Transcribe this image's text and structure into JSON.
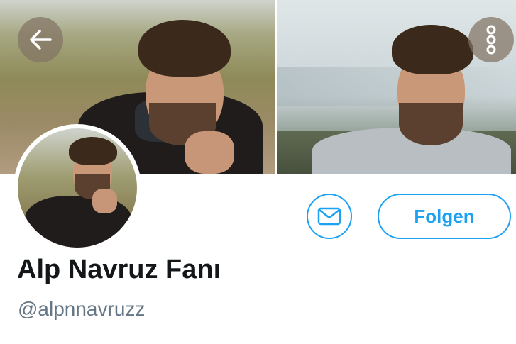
{
  "header": {
    "back_icon": "arrow-left-icon",
    "more_icon": "more-vertical-icon"
  },
  "actions": {
    "message_icon": "mail-icon",
    "follow_label": "Folgen",
    "accent_color": "#1da1f2"
  },
  "profile": {
    "display_name": "Alp Navruz Fanı",
    "handle": "@alpnnavruzz"
  }
}
